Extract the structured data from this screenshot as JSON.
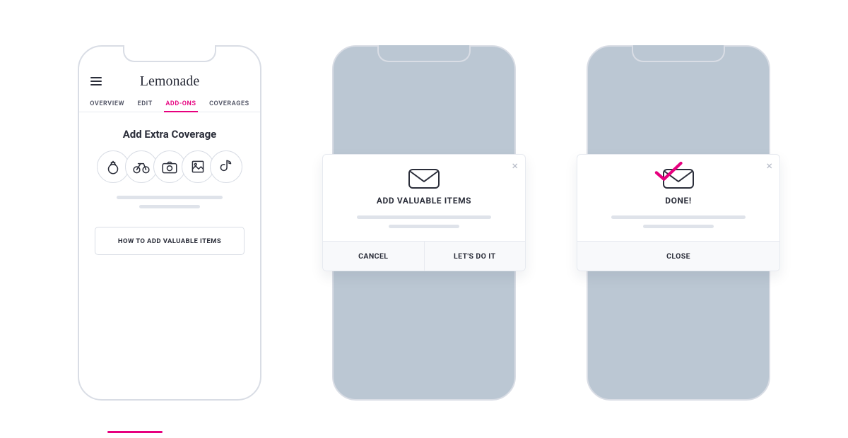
{
  "screen1": {
    "brand": "Lemonade",
    "tabs": [
      "OVERVIEW",
      "EDIT",
      "ADD-ONS",
      "COVERAGES"
    ],
    "active_tab_index": 2,
    "title": "Add Extra Coverage",
    "category_icons": [
      "ring-icon",
      "bicycle-icon",
      "camera-icon",
      "art-icon",
      "instrument-icon"
    ],
    "cta": "HOW TO ADD VALUABLE ITEMS"
  },
  "screen2": {
    "icon": "mail-icon",
    "title": "ADD VALUABLE ITEMS",
    "secondary": "CANCEL",
    "primary": "LET'S DO IT"
  },
  "screen3": {
    "icon": "mail-check-icon",
    "title": "DONE!",
    "primary": "CLOSE"
  }
}
